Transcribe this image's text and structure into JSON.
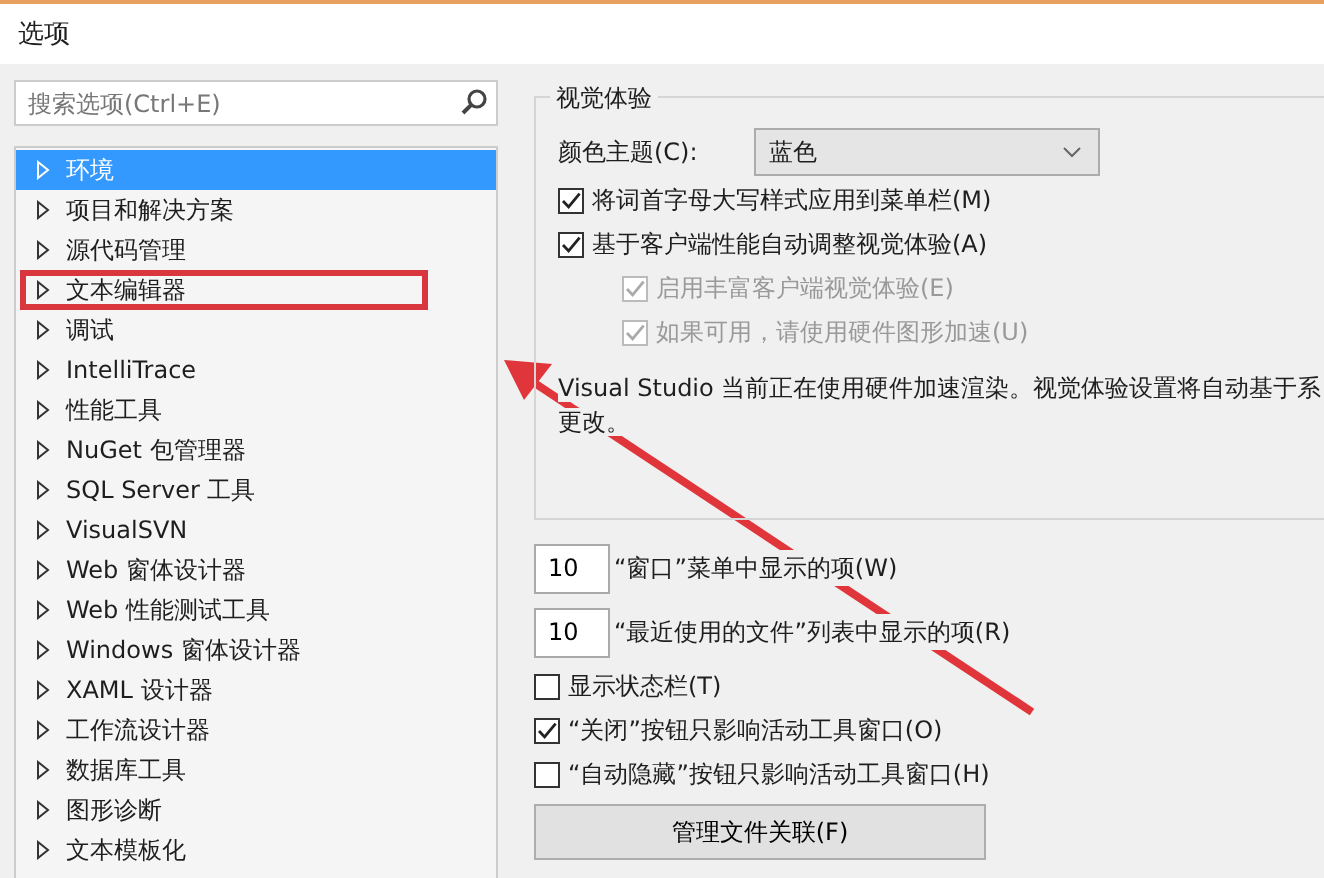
{
  "window": {
    "title": "选项"
  },
  "search": {
    "placeholder": "搜索选项(Ctrl+E)"
  },
  "tree": [
    {
      "label": "环境",
      "selected": true
    },
    {
      "label": "项目和解决方案",
      "selected": false
    },
    {
      "label": "源代码管理",
      "selected": false
    },
    {
      "label": "文本编辑器",
      "selected": false
    },
    {
      "label": "调试",
      "selected": false
    },
    {
      "label": "IntelliTrace",
      "selected": false
    },
    {
      "label": "性能工具",
      "selected": false
    },
    {
      "label": "NuGet 包管理器",
      "selected": false
    },
    {
      "label": "SQL Server 工具",
      "selected": false
    },
    {
      "label": "VisualSVN",
      "selected": false
    },
    {
      "label": "Web 窗体设计器",
      "selected": false
    },
    {
      "label": "Web 性能测试工具",
      "selected": false
    },
    {
      "label": "Windows 窗体设计器",
      "selected": false
    },
    {
      "label": "XAML 设计器",
      "selected": false
    },
    {
      "label": "工作流设计器",
      "selected": false
    },
    {
      "label": "数据库工具",
      "selected": false
    },
    {
      "label": "图形诊断",
      "selected": false
    },
    {
      "label": "文本模板化",
      "selected": false
    }
  ],
  "visual_group": {
    "title": "视觉体验",
    "theme_label": "颜色主题(C):",
    "theme_value": "蓝色",
    "options": [
      {
        "label": "将词首字母大写样式应用到菜单栏(M)",
        "checked": true,
        "disabled": false,
        "indented": false
      },
      {
        "label": "基于客户端性能自动调整视觉体验(A)",
        "checked": true,
        "disabled": false,
        "indented": false
      },
      {
        "label": "启用丰富客户端视觉体验(E)",
        "checked": true,
        "disabled": true,
        "indented": true
      },
      {
        "label": "如果可用，请使用硬件图形加速(U)",
        "checked": true,
        "disabled": true,
        "indented": true
      }
    ],
    "note_lines": [
      "Visual Studio 当前正在使用硬件加速渲染。视觉体验设置将自动基于系",
      "更改。"
    ]
  },
  "counts": [
    {
      "value": "10",
      "label": "“窗口”菜单中显示的项(W)"
    },
    {
      "value": "10",
      "label": "“最近使用的文件”列表中显示的项(R)"
    }
  ],
  "options": [
    {
      "label": "显示状态栏(T)",
      "checked": false
    },
    {
      "label": "“关闭”按钮只影响活动工具窗口(O)",
      "checked": true
    },
    {
      "label": "“自动隐藏”按钮只影响活动工具窗口(H)",
      "checked": false
    }
  ],
  "button": "管理文件关联(F)"
}
